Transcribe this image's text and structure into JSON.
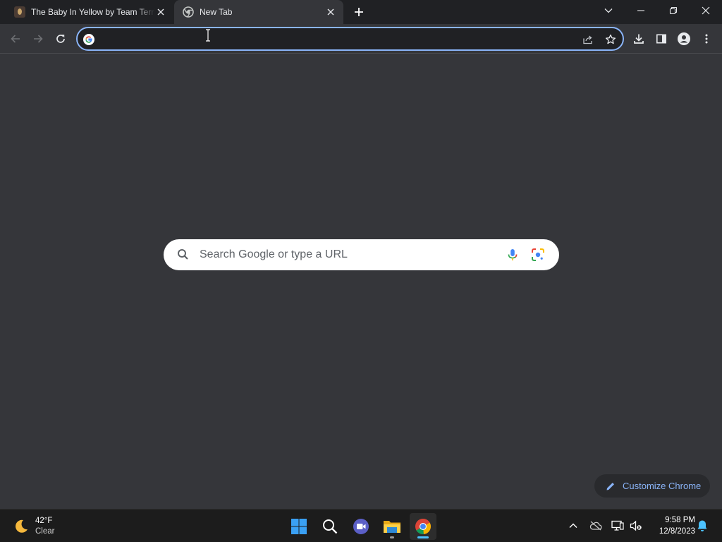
{
  "tabs": [
    {
      "title": "The Baby In Yellow by Team Terrible",
      "active": false
    },
    {
      "title": "New Tab",
      "active": true
    }
  ],
  "omnibox": {
    "value": "",
    "placeholder": ""
  },
  "ntp": {
    "search_placeholder": "Search Google or type a URL",
    "customize_label": "Customize Chrome"
  },
  "taskbar": {
    "weather": {
      "temp": "42°F",
      "condition": "Clear"
    },
    "clock": {
      "time": "9:58 PM",
      "date": "12/8/2023"
    },
    "apps": [
      "windows-start",
      "search",
      "teams-meet",
      "file-explorer",
      "chrome"
    ]
  },
  "colors": {
    "tabstrip_bg": "#202124",
    "toolbar_bg": "#35363a",
    "page_bg": "#35363a",
    "accent": "#8ab4f8",
    "taskbar_bg": "#1c1c1c"
  }
}
